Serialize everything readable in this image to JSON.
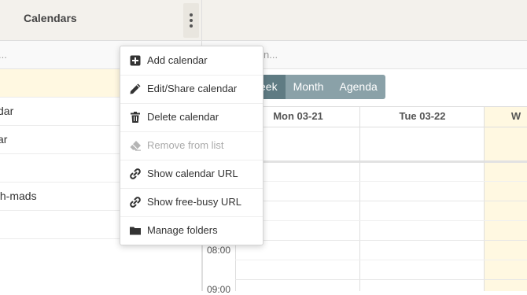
{
  "sidebar": {
    "title": "Calendars",
    "search_placeholder": "...",
    "items": [
      {
        "label": ""
      },
      {
        "label": "dar"
      },
      {
        "label": "ar"
      },
      {
        "label": ""
      },
      {
        "label": "th-mads"
      },
      {
        "label": ""
      }
    ]
  },
  "main": {
    "search_placeholder": "n...",
    "views": [
      "eek",
      "Month",
      "Agenda"
    ],
    "active_view": "eek",
    "days": [
      "Mon 03-21",
      "Tue 03-22",
      "W"
    ],
    "times": [
      "08:00",
      "09:00"
    ]
  },
  "menu": {
    "items": [
      {
        "label": "Add calendar",
        "icon": "plus-square-icon",
        "enabled": true
      },
      {
        "label": "Edit/Share calendar",
        "icon": "pencil-icon",
        "enabled": true
      },
      {
        "label": "Delete calendar",
        "icon": "trash-icon",
        "enabled": true
      },
      {
        "label": "Remove from list",
        "icon": "eraser-icon",
        "enabled": false
      },
      {
        "label": "Show calendar URL",
        "icon": "link-icon",
        "enabled": true
      },
      {
        "label": "Show free-busy URL",
        "icon": "link-icon",
        "enabled": true
      },
      {
        "label": "Manage folders",
        "icon": "folder-icon",
        "enabled": true
      }
    ]
  },
  "colors": {
    "header_bg": "#f3f1ec",
    "view_button": "#8aa1a8",
    "view_button_active": "#5f7b83",
    "today_highlight": "#fff8e1"
  }
}
